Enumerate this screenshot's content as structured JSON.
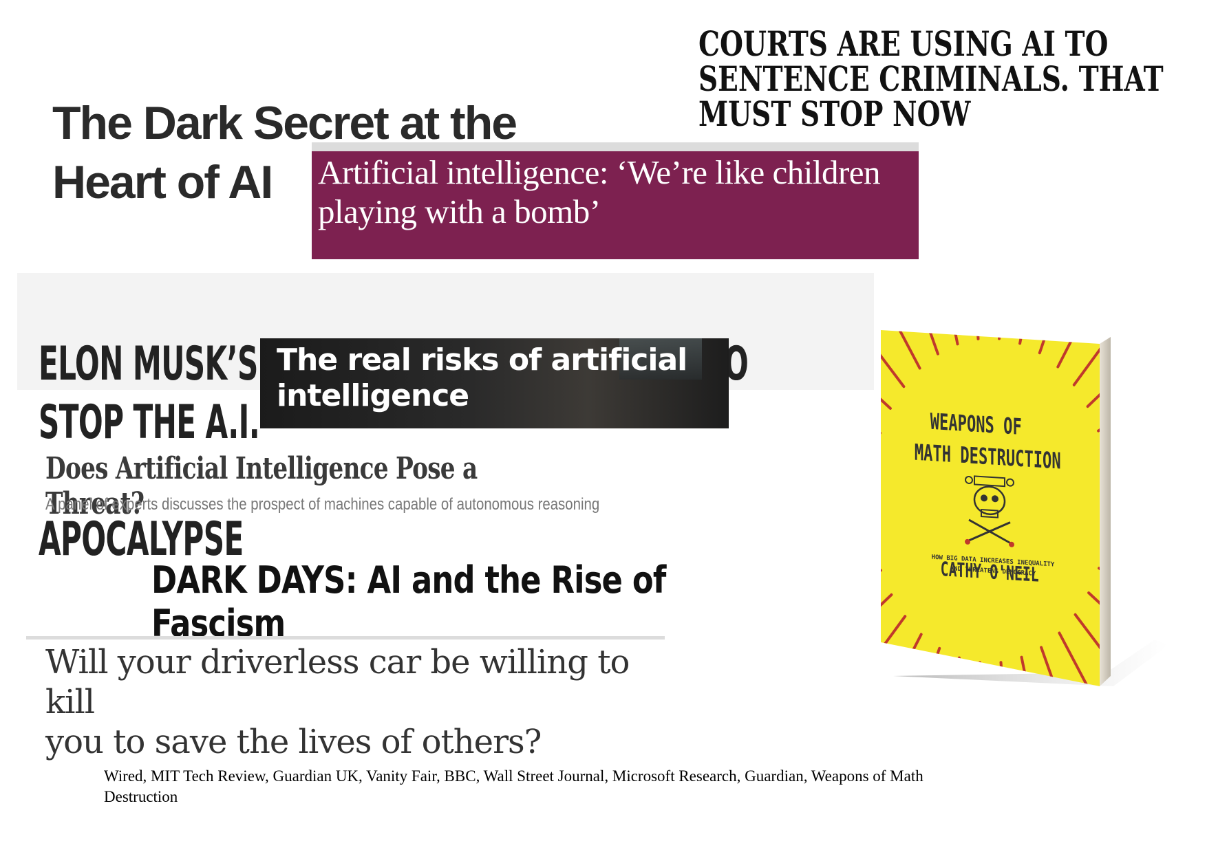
{
  "headlines": {
    "wired": {
      "line1": "The Dark Secret at the",
      "line2": "Heart of AI"
    },
    "courts": {
      "line1": "COURTS ARE USING AI TO",
      "line2": "SENTENCE CRIMINALS. THAT",
      "line3": "MUST STOP NOW"
    },
    "guardian_uk": {
      "line1": "Artificial intelligence: ‘We’re like children",
      "line2": "playing with a bomb’"
    },
    "vanity_fair": {
      "line1": "ELON MUSK’S BILLION-DOLLAR CRUSADE TO STOP THE A.I.",
      "line2": "APOCALYPSE"
    },
    "bbc": {
      "line1": "The real risks of artificial",
      "line2": "intelligence"
    },
    "wsj": {
      "title": "Does Artificial Intelligence Pose a Threat?",
      "subtitle": "A panel of experts discusses the prospect of machines capable of autonomous reasoning"
    },
    "microsoft": {
      "text": "DARK DAYS: AI and the Rise of Fascism"
    },
    "guardian": {
      "line1": "Will your driverless car be willing to kill",
      "line2": "you to save the lives of others?"
    }
  },
  "book": {
    "title_line1": "WEAPONS OF",
    "title_line2": "MATH DESTRUCTION",
    "subtitle_line1": "HOW BIG DATA INCREASES INEQUALITY",
    "subtitle_line2": "AND THREATENS DEMOCRACY",
    "author": "CATHY O'NEIL",
    "cover_color": "#f5e92c",
    "ray_color": "#c0392b"
  },
  "sources": {
    "line1": "Wired, MIT Tech Review, Guardian UK, Vanity Fair, BBC,  Wall Street Journal,  Microsoft Research, Guardian, Weapons of Math",
    "line2": "Destruction"
  }
}
